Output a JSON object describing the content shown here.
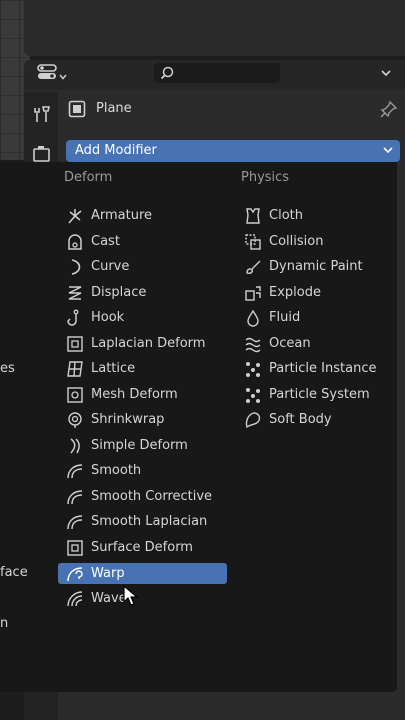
{
  "header": {
    "editor_type_icon": "properties-editor-icon",
    "search_value": "",
    "options_icon": "chevron-down-icon"
  },
  "tabs": [
    {
      "name": "tool-tab",
      "icon": "wrench-screwdriver-icon"
    },
    {
      "name": "render-tab",
      "icon": "camera-back-icon"
    }
  ],
  "object": {
    "name": "Plane",
    "icon": "object-square-icon",
    "pin_icon": "pin-icon"
  },
  "add_modifier": {
    "label": "Add Modifier",
    "icon": "chevron-down-icon"
  },
  "menu": {
    "left_cut_items": [
      "es",
      "face",
      "n"
    ],
    "deform": {
      "title": "Deform",
      "items": [
        {
          "label": "Armature",
          "icon": "armature-icon"
        },
        {
          "label": "Cast",
          "icon": "cast-icon"
        },
        {
          "label": "Curve",
          "icon": "curve-icon"
        },
        {
          "label": "Displace",
          "icon": "displace-icon"
        },
        {
          "label": "Hook",
          "icon": "hook-icon"
        },
        {
          "label": "Laplacian Deform",
          "icon": "laplacian-deform-icon"
        },
        {
          "label": "Lattice",
          "icon": "lattice-icon"
        },
        {
          "label": "Mesh Deform",
          "icon": "mesh-deform-icon"
        },
        {
          "label": "Shrinkwrap",
          "icon": "shrinkwrap-icon"
        },
        {
          "label": "Simple Deform",
          "icon": "simple-deform-icon"
        },
        {
          "label": "Smooth",
          "icon": "smooth-icon"
        },
        {
          "label": "Smooth Corrective",
          "icon": "smooth-corrective-icon"
        },
        {
          "label": "Smooth Laplacian",
          "icon": "smooth-laplacian-icon"
        },
        {
          "label": "Surface Deform",
          "icon": "surface-deform-icon"
        },
        {
          "label": "Warp",
          "icon": "warp-icon",
          "selected": true
        },
        {
          "label": "Wave",
          "icon": "wave-icon"
        }
      ]
    },
    "physics": {
      "title": "Physics",
      "items": [
        {
          "label": "Cloth",
          "icon": "cloth-icon"
        },
        {
          "label": "Collision",
          "icon": "collision-icon"
        },
        {
          "label": "Dynamic Paint",
          "icon": "dynamic-paint-icon"
        },
        {
          "label": "Explode",
          "icon": "explode-icon"
        },
        {
          "label": "Fluid",
          "icon": "fluid-icon"
        },
        {
          "label": "Ocean",
          "icon": "ocean-icon"
        },
        {
          "label": "Particle Instance",
          "icon": "particle-instance-icon"
        },
        {
          "label": "Particle System",
          "icon": "particle-system-icon"
        },
        {
          "label": "Soft Body",
          "icon": "soft-body-icon"
        }
      ]
    }
  },
  "colors": {
    "accent": "#4772b3",
    "menu_bg": "#181818",
    "panel_bg": "#2b2b2b"
  }
}
